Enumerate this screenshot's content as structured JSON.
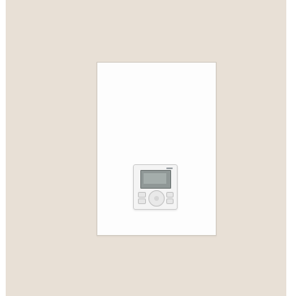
{
  "scene": {
    "subject": "wall-mounted-unit-with-controller",
    "colors": {
      "backdrop": "#e8e0d6",
      "panel": "#fdfdfd",
      "controller_body": "#f4f4f4",
      "controller_screen": "#8f9796"
    }
  }
}
